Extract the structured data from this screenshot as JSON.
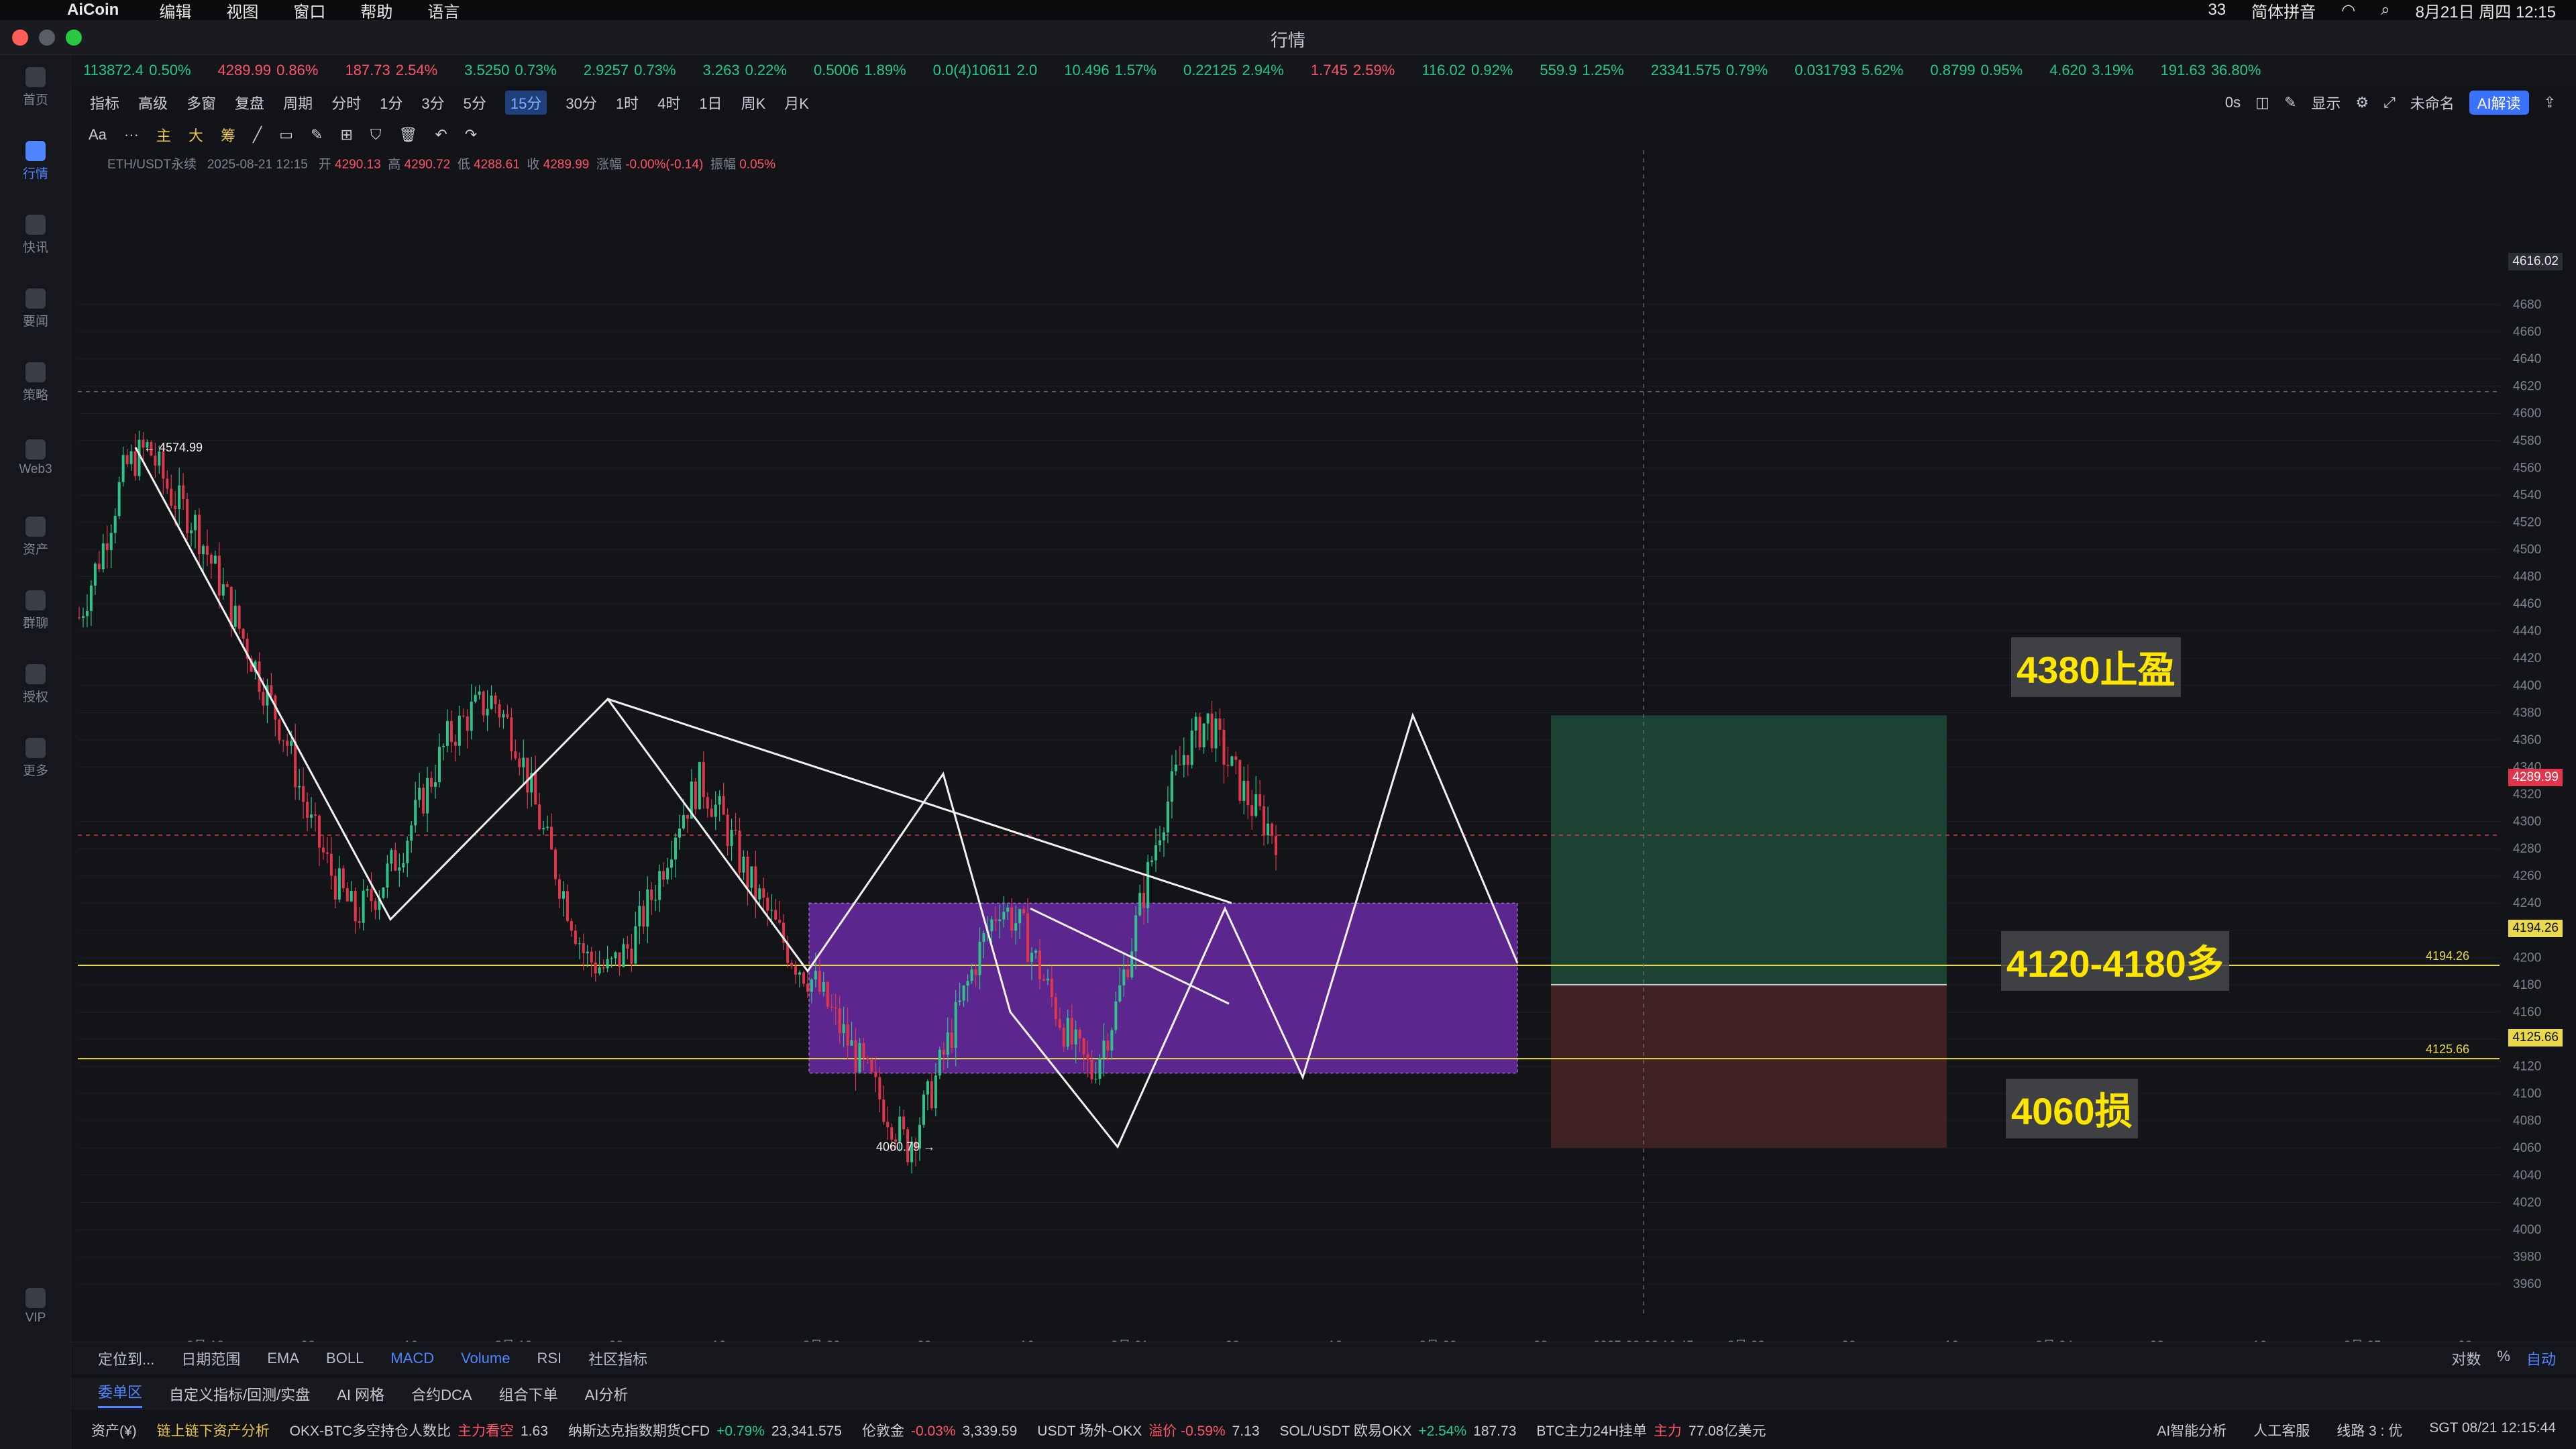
{
  "menubar": {
    "app": "AiCoin",
    "items": [
      "编辑",
      "视图",
      "窗口",
      "帮助",
      "语言"
    ],
    "right": [
      "33",
      "简体拼音",
      "8月21日 周四 12:15"
    ]
  },
  "window": {
    "title": "行情"
  },
  "sidebar": {
    "items": [
      {
        "label": "首页",
        "icon": "home-icon"
      },
      {
        "label": "行情",
        "icon": "chart-icon",
        "active": true
      },
      {
        "label": "快讯",
        "icon": "news-icon"
      },
      {
        "label": "要闻",
        "icon": "doc-icon"
      },
      {
        "label": "策略",
        "icon": "robot-icon"
      },
      {
        "label": "Web3",
        "icon": "web3-icon"
      },
      {
        "label": "资产",
        "icon": "wallet-icon"
      },
      {
        "label": "群聊",
        "icon": "chat-icon"
      },
      {
        "label": "授权",
        "icon": "key-icon"
      },
      {
        "label": "更多",
        "icon": "grid-icon"
      },
      {
        "label": "VIP",
        "icon": "vip-icon"
      }
    ]
  },
  "ticker": [
    {
      "price": "113872.4",
      "chg": "0.50%",
      "dir": "up"
    },
    {
      "price": "4289.99",
      "chg": "0.86%",
      "dir": "dn"
    },
    {
      "price": "187.73",
      "chg": "2.54%",
      "dir": "dn"
    },
    {
      "price": "3.5250",
      "chg": "0.73%",
      "dir": "up"
    },
    {
      "price": "2.9257",
      "chg": "0.73%",
      "dir": "up"
    },
    {
      "price": "3.263",
      "chg": "0.22%",
      "dir": "up"
    },
    {
      "price": "0.5006",
      "chg": "1.89%",
      "dir": "up"
    },
    {
      "price": "0.0(4)10611",
      "chg": "2.0",
      "dir": "up"
    },
    {
      "price": "10.496",
      "chg": "1.57%",
      "dir": "up"
    },
    {
      "price": "0.22125",
      "chg": "2.94%",
      "dir": "up"
    },
    {
      "price": "1.745",
      "chg": "2.59%",
      "dir": "dn"
    },
    {
      "price": "116.02",
      "chg": "0.92%",
      "dir": "up"
    },
    {
      "price": "559.9",
      "chg": "1.25%",
      "dir": "up"
    },
    {
      "price": "23341.575",
      "chg": "0.79%",
      "dir": "up"
    },
    {
      "price": "0.031793",
      "chg": "5.62%",
      "dir": "up"
    },
    {
      "price": "0.8799",
      "chg": "0.95%",
      "dir": "up"
    },
    {
      "price": "4.620",
      "chg": "3.19%",
      "dir": "up"
    },
    {
      "price": "191.63",
      "chg": "36.80%",
      "dir": "up"
    }
  ],
  "toolbar": {
    "items": [
      "指标",
      "高级",
      "多窗",
      "复盘",
      "周期",
      "分时",
      "1分",
      "3分",
      "5分",
      "15分",
      "30分",
      "1时",
      "4时",
      "1日",
      "周K",
      "月K"
    ],
    "selected": "15分",
    "draw_tools": [
      "Aa",
      "主",
      "大",
      "筹"
    ],
    "right": [
      "0s",
      "显示",
      "未命名",
      "AI解读"
    ]
  },
  "info": {
    "symbol": "ETH/USDT永续",
    "time": "2025-08-21 12:15",
    "open_label": "开",
    "open": "4290.13",
    "high_label": "高",
    "high": "4290.72",
    "low_label": "低",
    "low": "4288.61",
    "close_label": "收",
    "close": "4289.99",
    "chg_label": "涨幅",
    "chg": "-0.00%(-0.14)",
    "amp_label": "振幅",
    "amp": "0.05%"
  },
  "chart_data": {
    "type": "candlestick",
    "ylim": [
      3960,
      4680
    ],
    "y_ticks": [
      3960,
      3980,
      4000,
      4020,
      4040,
      4060,
      4080,
      4100,
      4120,
      4140,
      4160,
      4180,
      4200,
      4220,
      4240,
      4260,
      4280,
      4300,
      4320,
      4340,
      4360,
      4380,
      4400,
      4420,
      4440,
      4460,
      4480,
      4500,
      4520,
      4540,
      4560,
      4580,
      4600,
      4620,
      4640,
      4660,
      4680
    ],
    "x_ticks": [
      "8月 18",
      "08",
      "16",
      "8月 19",
      "08",
      "16",
      "8月 20",
      "08",
      "16",
      "8月 21",
      "08",
      "16",
      "8月 22",
      "08",
      "2025-08-22 16:45",
      "8月 23",
      "08",
      "16",
      "8月 24",
      "08",
      "16",
      "8月 25",
      "08"
    ],
    "close_series": [
      4450,
      4500,
      4560,
      4574.99,
      4540,
      4520,
      4480,
      4440,
      4400,
      4360,
      4300,
      4260,
      4230,
      4250,
      4280,
      4320,
      4360,
      4380,
      4390,
      4360,
      4300,
      4250,
      4200,
      4190,
      4210,
      4250,
      4300,
      4330,
      4300,
      4260,
      4230,
      4200,
      4180,
      4150,
      4120,
      4090,
      4060.79,
      4100,
      4150,
      4200,
      4240,
      4220,
      4180,
      4140,
      4115,
      4160,
      4230,
      4300,
      4350,
      4375,
      4340,
      4310,
      4289.99
    ],
    "candle_colors": {
      "up": "#2dc48a",
      "down": "#e0364c"
    },
    "last_price": "4289.99",
    "crosshair_price": "4616.02",
    "lines": [
      {
        "label": "4194.26",
        "value": 4194.26,
        "color": "#e8d84a"
      },
      {
        "label": "4125.66",
        "value": 4125.66,
        "color": "#e8d84a"
      }
    ],
    "swing_labels": [
      {
        "label": "4574.99",
        "value": 4574.99
      },
      {
        "label": "4060.79",
        "value": 4060.79
      }
    ],
    "zones": [
      {
        "name": "range",
        "low": 4115,
        "high": 4240,
        "color": "#7a2ec0"
      },
      {
        "name": "take-profit",
        "low": 4180,
        "high": 4378,
        "color": "#1f4a3a"
      },
      {
        "name": "stop-loss",
        "low": 4060,
        "high": 4180,
        "color": "#4a2424"
      }
    ]
  },
  "annotations": [
    {
      "id": "tp",
      "text": "4380止盈"
    },
    {
      "id": "entry",
      "text": "4120-4180多"
    },
    {
      "id": "sl",
      "text": "4060损"
    }
  ],
  "bottombar": {
    "items": [
      "定位到...",
      "日期范围",
      "EMA",
      "BOLL",
      "MACD",
      "Volume",
      "RSI",
      "社区指标"
    ],
    "right": [
      "对数",
      "%",
      "自动"
    ]
  },
  "tabs": [
    "委单区",
    "自定义指标/回测/实盘",
    "AI 网格",
    "合约DCA",
    "组合下单",
    "AI分析"
  ],
  "status": {
    "asset": "资产(¥)",
    "onchain": "链上链下资产分析",
    "items": [
      {
        "name": "OKX-BTC多空持仓人数比",
        "tag": "主力看空",
        "val": "1.63"
      },
      {
        "name": "纳斯达克指数期货CFD",
        "chg": "+0.79%",
        "val": "23,341.575"
      },
      {
        "name": "伦敦金",
        "chg": "-0.03%",
        "val": "3,339.59"
      },
      {
        "name": "USDT 场外-OKX",
        "tag": "溢价 -0.59%",
        "val": "7.13"
      },
      {
        "name": "SOL/USDT 欧易OKX",
        "chg": "+2.54%",
        "val": "187.73"
      },
      {
        "name": "BTC主力24H挂单",
        "tag": "主力",
        "val": "77.08亿美元"
      }
    ],
    "right": [
      "AI智能分析",
      "人工客服",
      "线路 3 : 优",
      "SGT 08/21 12:15:44"
    ]
  }
}
